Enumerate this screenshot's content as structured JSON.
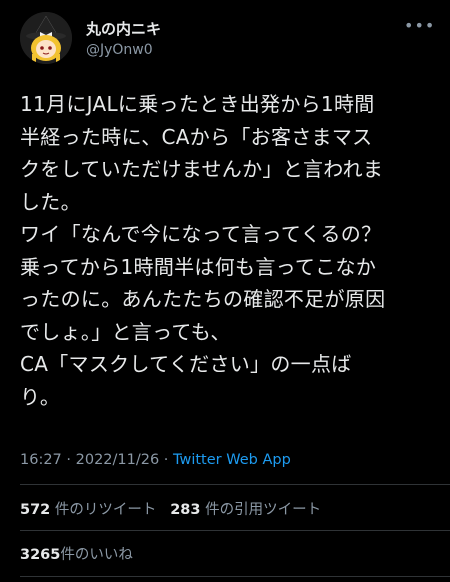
{
  "user": {
    "display_name": "丸の内ニキ",
    "handle": "@JyOnw0",
    "avatar_icon": "avatar-icon",
    "more_icon": "more-icon"
  },
  "tweet": {
    "lines": [
      "11月にJALに乗ったとき出発から1時間",
      "半経った時に、CAから「お客さまマス",
      "クをしていただけませんか」と言われま",
      "した。",
      "ワイ「なんで今になって言ってくるの？",
      "乗ってから1時間半は何も言ってこなか",
      "ったのに。あんたたちの確認不足が原因",
      "でしょ。」と言っても、",
      "CA「マスクしてください」の一点ば",
      "り。"
    ]
  },
  "meta": {
    "time": "16:27",
    "separator1": " · ",
    "date": "2022/11/26",
    "separator2": " · ",
    "source": "Twitter Web App"
  },
  "stats": {
    "retweets_count": "572",
    "retweets_label": "件のリツイート",
    "quotes_count": "283",
    "quotes_label": "件の引用ツイート",
    "likes_count": "3265",
    "likes_label": "件のいいね"
  }
}
